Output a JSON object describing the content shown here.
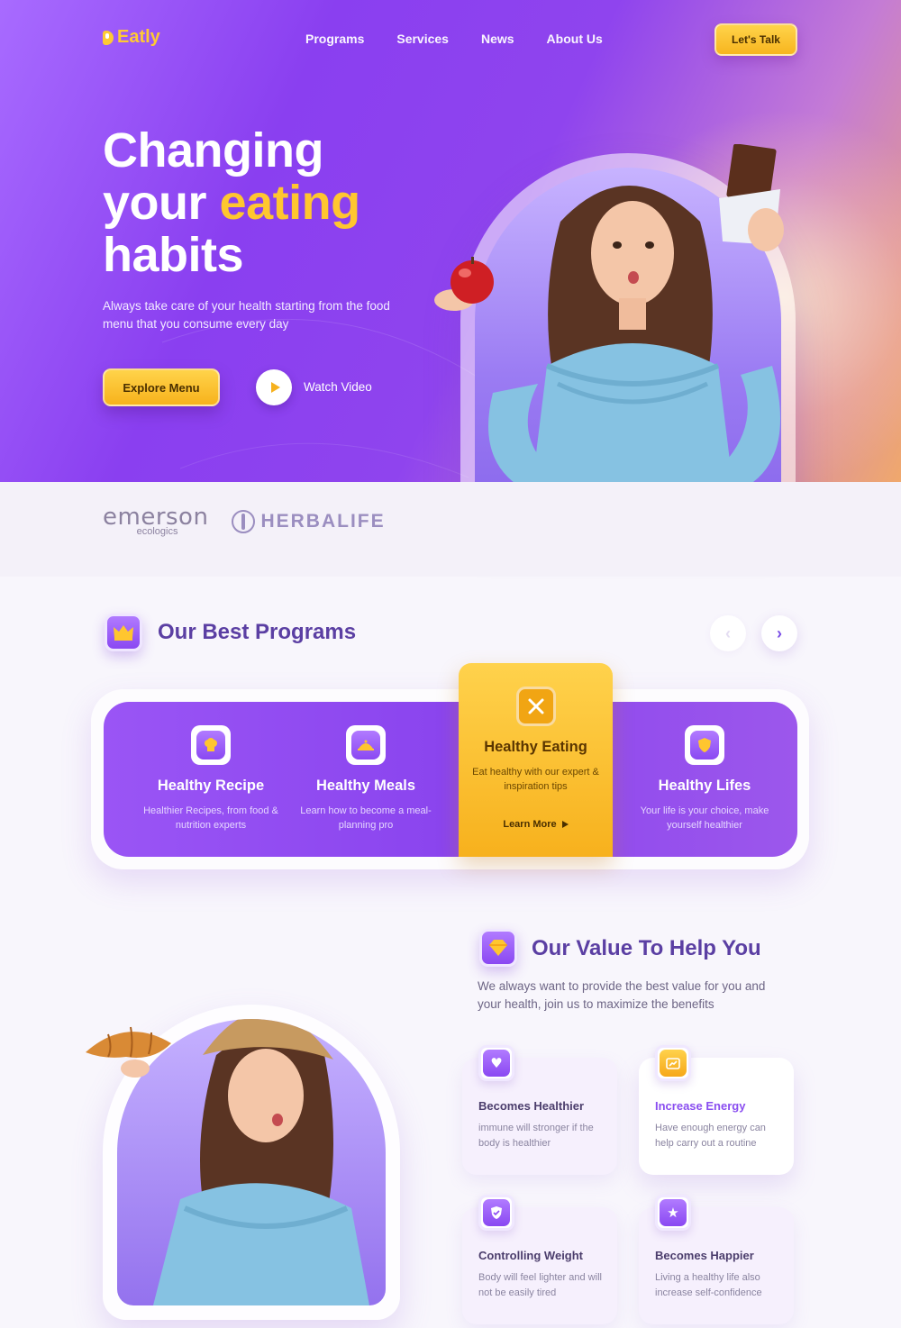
{
  "brand": {
    "name": "Eatly"
  },
  "nav": {
    "items": [
      "Programs",
      "Services",
      "News",
      "About Us"
    ],
    "cta": "Let's Talk"
  },
  "hero": {
    "line1": "Changing",
    "line2a": "your ",
    "line2b": "eating",
    "line3": "habits",
    "subtitle": "Always take care of your health starting from the food menu that you consume every day",
    "primary_cta": "Explore Menu",
    "secondary_cta": "Watch Video"
  },
  "partners": {
    "p1": "emerson",
    "p1_sub": "ecologics",
    "p2": "HERBALIFE"
  },
  "programs": {
    "title": "Our Best Programs",
    "cards": [
      {
        "title": "Healthy Recipe",
        "desc": "Healthier Recipes, from food & nutrition experts",
        "icon": "chef-hat-icon"
      },
      {
        "title": "Healthy Meals",
        "desc": "Learn how to become a meal-planning pro",
        "icon": "food-cloche-icon"
      },
      {
        "title": "Healthy Eating",
        "desc": "Eat healthy with our expert & inspiration tips",
        "icon": "utensils-icon",
        "link": "Learn More"
      },
      {
        "title": "Healthy Lifes",
        "desc": "Your life is your choice, make yourself healthier",
        "icon": "shield-icon"
      }
    ]
  },
  "value": {
    "title": "Our Value To Help You",
    "subtitle": "We always want to provide the best value for you and your health, join us to maximize the benefits",
    "cards": [
      {
        "title": "Becomes Healthier",
        "desc": "immune will stronger if the body is healthier",
        "icon": "heart-icon"
      },
      {
        "title": "Increase Energy",
        "desc": "Have enough energy can help carry out a routine",
        "icon": "energy-chart-icon"
      },
      {
        "title": "Controlling Weight",
        "desc": "Body will feel lighter and will not be easily tired",
        "icon": "shield-check-icon"
      },
      {
        "title": "Becomes Happier",
        "desc": "Living a healthy life also increase self-confidence",
        "icon": "star-icon"
      }
    ]
  },
  "colors": {
    "accent": "#ffc62f",
    "primary": "#8a44ee",
    "heading": "#5b3fa3"
  }
}
